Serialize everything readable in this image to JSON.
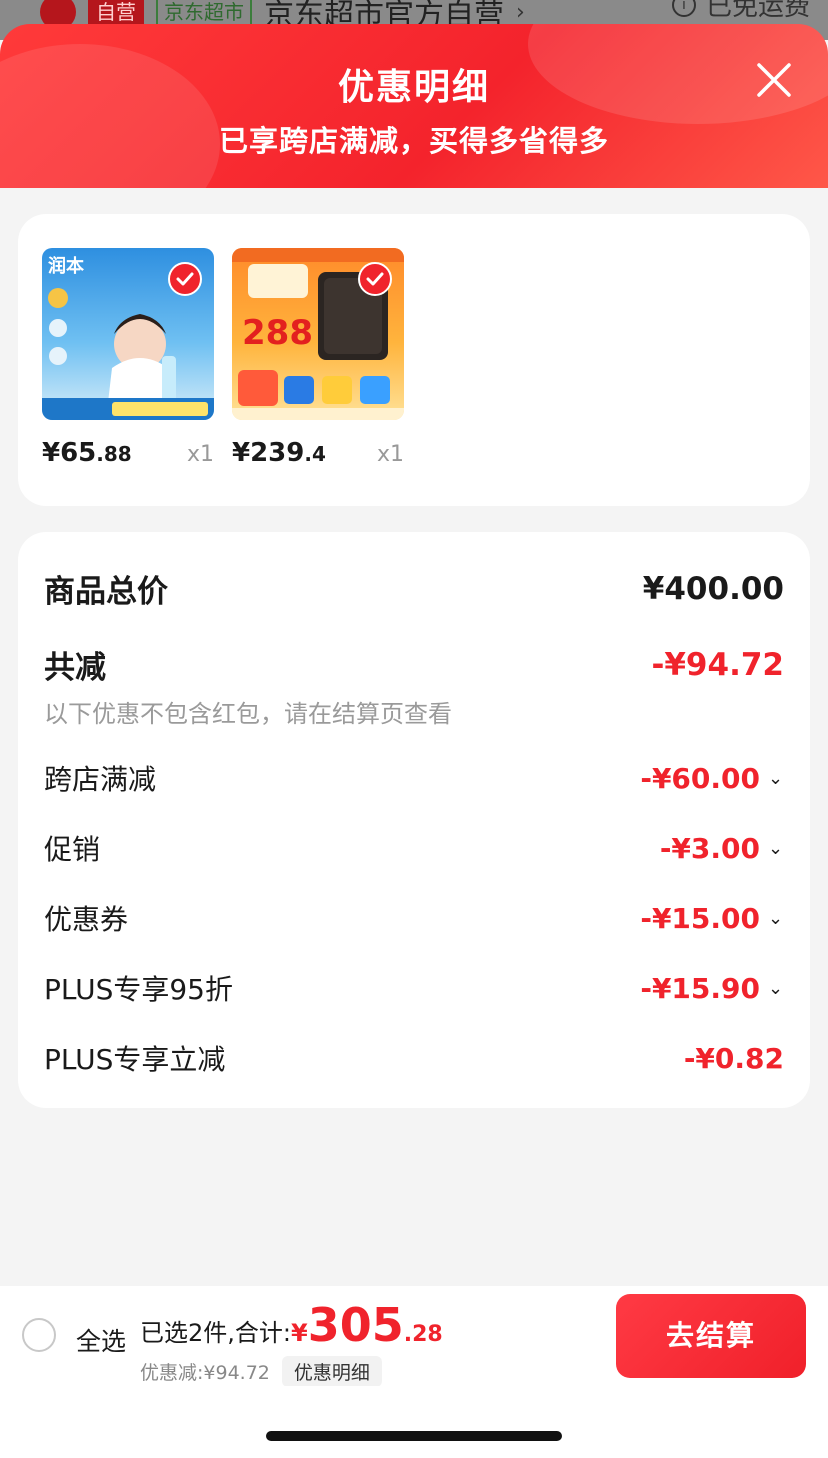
{
  "background": {
    "badge_self": "自营",
    "badge_store": "京东超市",
    "store_name": "京东超市官方自营",
    "free_shipping": "已免运费"
  },
  "header": {
    "title": "优惠明细",
    "subtitle": "已享跨店满减，买得多省得多",
    "close_icon": "close-icon",
    "colors": {
      "gradient_start": "#ff3a3a",
      "gradient_end": "#f4232c"
    }
  },
  "products": [
    {
      "thumb_text": "润本",
      "price_int": "¥65",
      "price_dec": ".88",
      "qty": "x1",
      "selected": true
    },
    {
      "thumb_text": "288",
      "price_int": "¥239",
      "price_dec": ".4",
      "qty": "x1",
      "selected": true
    }
  ],
  "details": {
    "total_label": "商品总价",
    "total_value": "¥400.00",
    "reduction_label": "共减",
    "reduction_value": "-¥94.72",
    "note": "以下优惠不包含红包，请在结算页查看",
    "items": [
      {
        "label": "跨店满减",
        "value": "-¥60.00",
        "expand": "chevron-down-icon"
      },
      {
        "label": "促销",
        "value": "-¥3.00",
        "expand": "chevron-down-icon"
      },
      {
        "label": "优惠券",
        "value": "-¥15.00",
        "expand": "chevron-down-icon"
      },
      {
        "label": "PLUS专享95折",
        "value": "-¥15.90",
        "expand": "chevron-down-icon"
      },
      {
        "label": "PLUS专享立减",
        "value": "-¥0.82"
      }
    ]
  },
  "footer": {
    "select_all": "全选",
    "summary_label": "已选2件,合计:",
    "currency": "¥",
    "total_int": "305",
    "total_dec": ".28",
    "saved": "优惠减:¥94.72",
    "detail_link": "优惠明细",
    "checkout": "去结算",
    "accent": "#f0232c"
  }
}
